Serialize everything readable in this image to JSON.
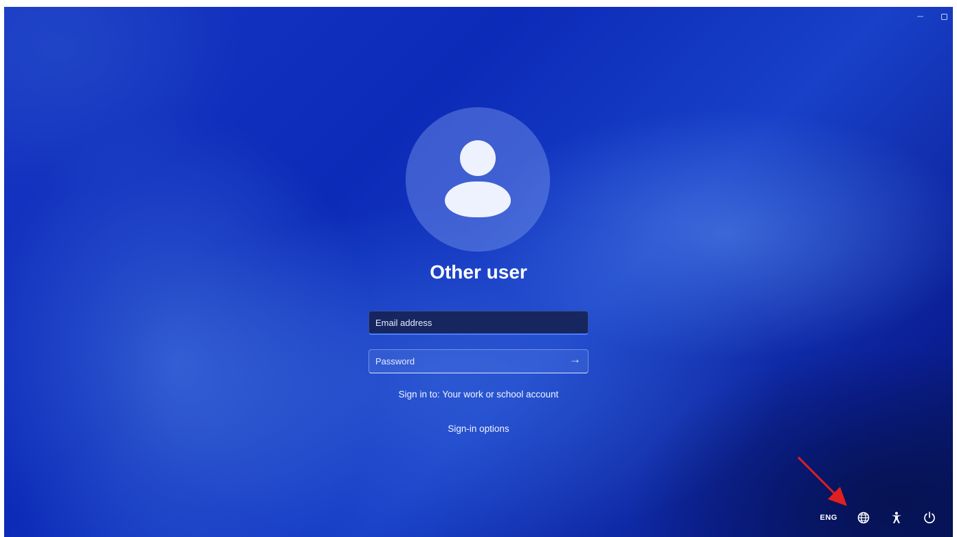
{
  "window": {
    "minimize_glyph": "–",
    "restore_glyph": ""
  },
  "login": {
    "username": "Other user",
    "email_placeholder": "Email address",
    "password_placeholder": "Password",
    "submit_glyph": "→",
    "sign_in_to": "Sign in to: Your work or school account",
    "sign_in_options": "Sign-in options"
  },
  "tray": {
    "language": "ENG",
    "icons": [
      "network-icon",
      "accessibility-icon",
      "power-icon"
    ]
  },
  "annotation": {
    "arrow_color": "#e02020"
  },
  "colors": {
    "background_primary": "#1736c4",
    "background_dark": "#071565",
    "text": "#ffffff",
    "focus_accent": "#4b7dff"
  }
}
